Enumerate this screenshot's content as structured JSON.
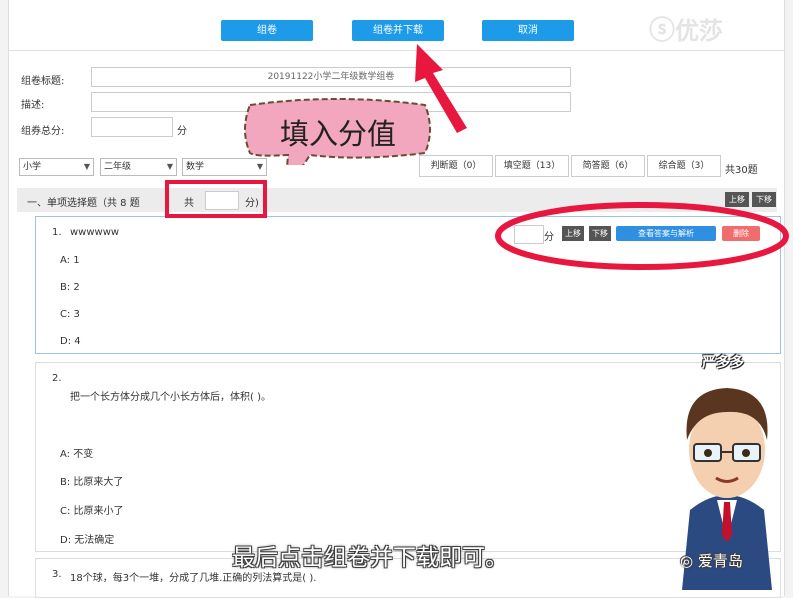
{
  "toolbar": {
    "btn1": "组卷",
    "btn2": "组卷并下载",
    "btn3": "取消"
  },
  "watermark": {
    "logo": "优莎"
  },
  "form": {
    "title_label": "组卷标题:",
    "title_value": "20191122小学二年级数学组卷",
    "desc_label": "描述:",
    "score_label": "组券总分:",
    "score_unit": "分"
  },
  "filters": {
    "stage": "小学",
    "grade": "二年级",
    "subject": "数学"
  },
  "type_tabs": [
    {
      "label": "判断题（0）"
    },
    {
      "label": "填空题（13）"
    },
    {
      "label": "简答题（6）"
    },
    {
      "label": "综合题（3）"
    }
  ],
  "total_label": "共30题",
  "section": {
    "title": "一、单项选择题（共 8 题",
    "score_prefix": "共",
    "score_suffix": "分)",
    "up": "上移",
    "down": "下移"
  },
  "callout": {
    "text": "填入分值"
  },
  "q1": {
    "num": "1.",
    "stem": "wwwwww",
    "options": [
      "A:  1",
      "B:  2",
      "C:  3",
      "D:  4"
    ],
    "score_unit": "分",
    "up": "上移",
    "down": "下移",
    "view": "查看答案与解析",
    "delete": "删除"
  },
  "q2": {
    "num": "2.",
    "stem": "把一个长方体分成几个小长方体后，体积( )。",
    "options": [
      "A:  不变",
      "B:  比原来大了",
      "C:  比原来小了",
      "D:  无法确定"
    ]
  },
  "q3": {
    "num": "3.",
    "stem": "18个球，每3个一堆，分成了几堆.正确的列法算式是( )."
  },
  "character": {
    "name": "严多多"
  },
  "subtitle": "最后点击组卷并下载即可。",
  "badge": {
    "name": "爱青岛"
  },
  "colors": {
    "primary": "#1e9be8",
    "highlight": "#e8173f",
    "danger": "#f06d6d"
  }
}
